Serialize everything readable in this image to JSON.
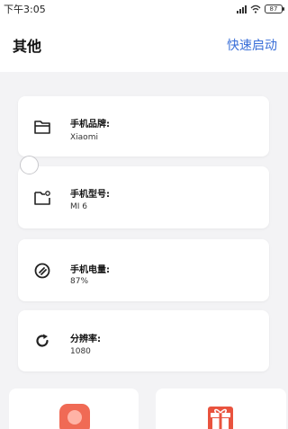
{
  "status_bar": {
    "time": "下午3:05",
    "battery": "87",
    "icons": [
      "signal-icon",
      "wifi-icon",
      "battery-icon"
    ]
  },
  "header": {
    "title": "其他",
    "action_label": "快速启动",
    "action_color": "#3a6fd8"
  },
  "cards": [
    {
      "icon": "folder-icon",
      "label": "手机品牌:",
      "value": "Xiaomi"
    },
    {
      "icon": "folder-plus-icon",
      "label": "手机型号:",
      "value": "MI 6"
    },
    {
      "icon": "battery-gauge-icon",
      "label": "手机电量:",
      "value": "87%"
    },
    {
      "icon": "refresh-icon",
      "label": "分辨率:",
      "value": "1080"
    }
  ],
  "bottom_tiles": [
    {
      "icon": "app-tile-icon",
      "color": "#f06a55"
    },
    {
      "icon": "gift-icon",
      "color": "#e9533e"
    }
  ]
}
